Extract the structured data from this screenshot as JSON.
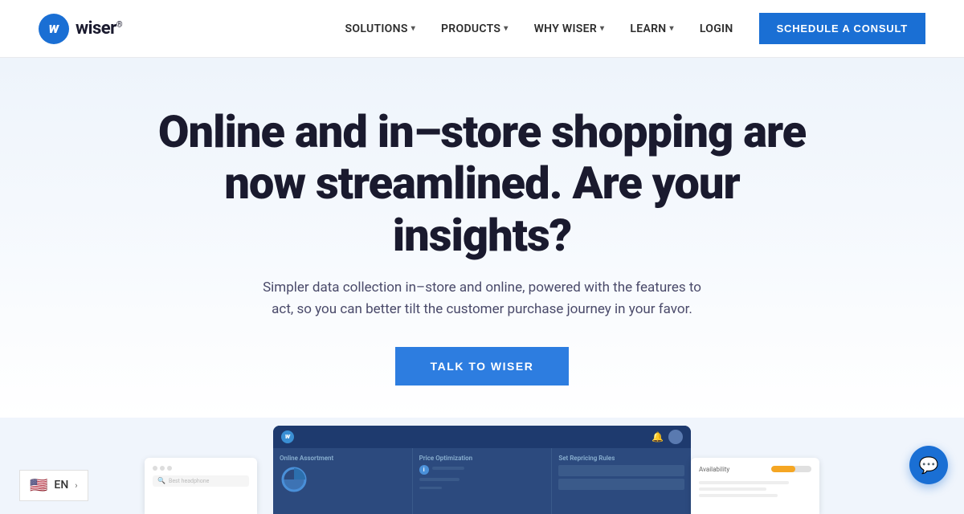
{
  "header": {
    "logo_letter": "w",
    "logo_name": "wiser",
    "logo_trademark": "®",
    "nav": {
      "items": [
        {
          "id": "solutions",
          "label": "SOLUTIONS",
          "has_dropdown": true
        },
        {
          "id": "products",
          "label": "PRODUCTS",
          "has_dropdown": true
        },
        {
          "id": "why_wiser",
          "label": "WHY WISER",
          "has_dropdown": true
        },
        {
          "id": "learn",
          "label": "LEARN",
          "has_dropdown": true
        }
      ],
      "login_label": "LOGIN",
      "cta_label": "SCHEDULE A CONSULT"
    }
  },
  "hero": {
    "title": "Online and in–store shopping are now streamlined. Are your insights?",
    "subtitle": "Simpler data collection in–store and online, powered with the features to act, so you can better tilt the customer purchase journey in your favor.",
    "cta_label": "TALK TO WISER"
  },
  "preview": {
    "lang_selector": {
      "flag": "🇺🇸",
      "lang": "EN",
      "chevron": "›"
    },
    "dashboard": {
      "col1_title": "Online Assortment",
      "col2_title": "Price Optimization",
      "col3_title": "Set Repricing Rules"
    },
    "right_card": {
      "availability_label": "Availability"
    }
  },
  "chat": {
    "icon": "💬"
  },
  "colors": {
    "primary": "#1a6fd4",
    "cta_blue": "#2d7de0",
    "dark_text": "#1a1a2e",
    "subtitle_text": "#4a4a6a"
  }
}
